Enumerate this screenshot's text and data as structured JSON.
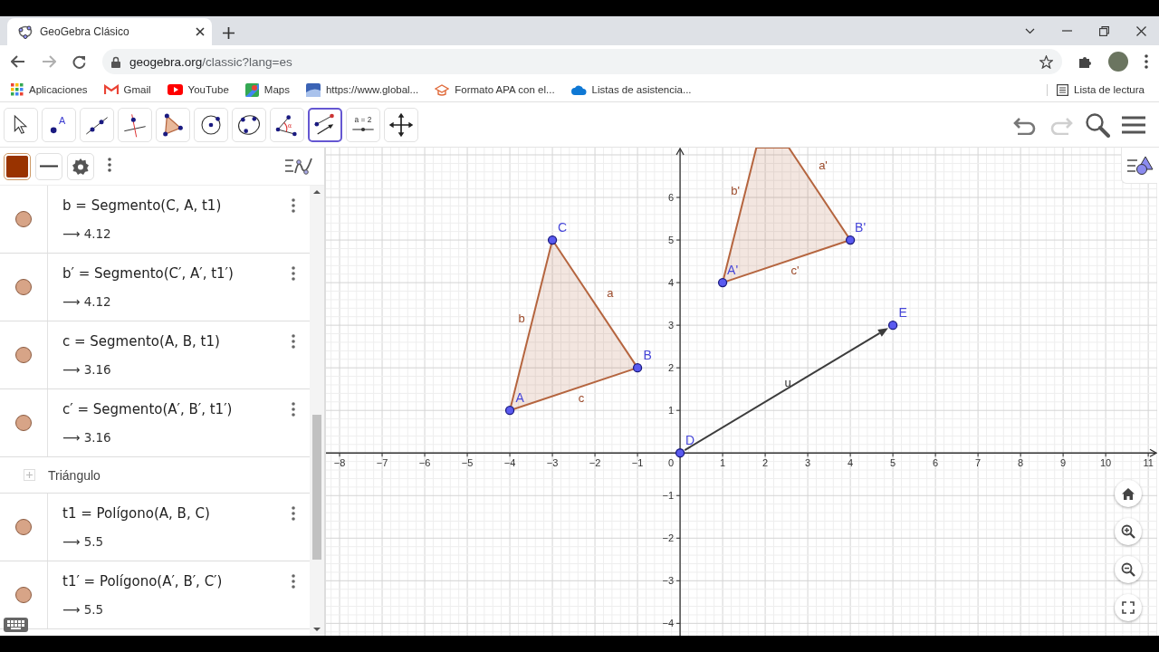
{
  "browser": {
    "tab": {
      "title": "GeoGebra Clásico"
    },
    "address": {
      "host": "geogebra.org",
      "path": "/classic?lang=es"
    },
    "bookmarks": [
      {
        "kind": "apps",
        "label": "Aplicaciones"
      },
      {
        "kind": "gmail",
        "label": "Gmail"
      },
      {
        "kind": "youtube",
        "label": "YouTube"
      },
      {
        "kind": "maps",
        "label": "Maps"
      },
      {
        "kind": "site",
        "label": "https://www.global..."
      },
      {
        "kind": "cap",
        "label": "Formato APA con el..."
      },
      {
        "kind": "cloud",
        "label": "Listas de asistencia..."
      }
    ],
    "reading_list": "Lista de lectura"
  },
  "toolbar": {
    "tools": [
      {
        "kind": "move",
        "selected": false
      },
      {
        "kind": "point",
        "label": "A",
        "selected": false
      },
      {
        "kind": "line",
        "selected": false
      },
      {
        "kind": "perpendicular",
        "selected": false
      },
      {
        "kind": "polygon",
        "selected": false
      },
      {
        "kind": "circle",
        "selected": false
      },
      {
        "kind": "conic",
        "selected": false
      },
      {
        "kind": "angle",
        "label": "α",
        "selected": false
      },
      {
        "kind": "vector",
        "selected": true
      },
      {
        "kind": "slider",
        "label": "a = 2",
        "selected": false
      },
      {
        "kind": "pan",
        "selected": false
      }
    ],
    "actions": [
      {
        "kind": "undo",
        "disabled": false
      },
      {
        "kind": "redo",
        "disabled": true
      },
      {
        "kind": "search"
      },
      {
        "kind": "menu"
      }
    ]
  },
  "algebra": {
    "rows": [
      {
        "kind": "expression",
        "visible": true,
        "expression": "b = Segmento(C, A, t1)",
        "value": "⟶ 4.12"
      },
      {
        "kind": "expression",
        "visible": true,
        "expression": "b′ = Segmento(C′, A′, t1′)",
        "value": "⟶ 4.12"
      },
      {
        "kind": "expression",
        "visible": true,
        "expression": "c = Segmento(A, B, t1)",
        "value": "⟶ 3.16"
      },
      {
        "kind": "expression",
        "visible": true,
        "expression": "c′ = Segmento(A′, B′, t1′)",
        "value": "⟶ 3.16"
      },
      {
        "kind": "group",
        "label": "Triángulo"
      },
      {
        "kind": "expression",
        "visible": true,
        "expression": "t1 = Polígono(A, B, C)",
        "value": "⟶ 5.5"
      },
      {
        "kind": "expression",
        "visible": true,
        "expression": "t1′ = Polígono(A′, B′, C′)",
        "value": "⟶ 5.5"
      }
    ]
  },
  "graphics": {
    "x_ticks": [
      "−8",
      "−7",
      "−6",
      "−5",
      "−4",
      "−3",
      "−2",
      "−1",
      "0",
      "1",
      "2",
      "3",
      "4",
      "5",
      "6",
      "7",
      "8",
      "9",
      "10",
      "11"
    ],
    "y_ticks": [
      "6",
      "5",
      "4",
      "3",
      "2",
      "1",
      "−1",
      "−2",
      "−3",
      "−4"
    ],
    "points": [
      {
        "label": "A"
      },
      {
        "label": "B"
      },
      {
        "label": "C"
      },
      {
        "label": "A'"
      },
      {
        "label": "B'"
      },
      {
        "label": "D"
      },
      {
        "label": "E"
      }
    ],
    "segments": [
      {
        "label": "a"
      },
      {
        "label": "b"
      },
      {
        "label": "c"
      },
      {
        "label": "a'"
      },
      {
        "label": "b'"
      },
      {
        "label": "c'"
      }
    ],
    "vectors": [
      {
        "label": "u"
      }
    ]
  }
}
